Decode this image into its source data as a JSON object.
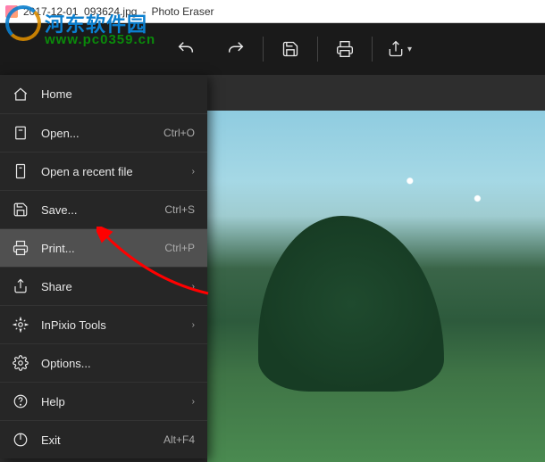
{
  "titlebar": {
    "filename": "2017-12-01_093624.jpg",
    "app_name": "Photo Eraser"
  },
  "watermark": {
    "text_main": "河东软件园",
    "text_url": "www.pc0359.cn"
  },
  "toolbar": {
    "undo_icon": "undo-icon",
    "redo_icon": "redo-icon",
    "save_icon": "save-icon",
    "print_icon": "print-icon",
    "share_icon": "share-icon"
  },
  "menu": {
    "items": [
      {
        "icon": "home-icon",
        "label": "Home",
        "shortcut": "",
        "has_sub": false,
        "highlighted": false
      },
      {
        "icon": "open-icon",
        "label": "Open...",
        "shortcut": "Ctrl+O",
        "has_sub": false,
        "highlighted": false
      },
      {
        "icon": "recent-icon",
        "label": "Open a recent file",
        "shortcut": "",
        "has_sub": true,
        "highlighted": false
      },
      {
        "icon": "save-icon",
        "label": "Save...",
        "shortcut": "Ctrl+S",
        "has_sub": false,
        "highlighted": false
      },
      {
        "icon": "print-icon",
        "label": "Print...",
        "shortcut": "Ctrl+P",
        "has_sub": false,
        "highlighted": true
      },
      {
        "icon": "share-icon",
        "label": "Share",
        "shortcut": "",
        "has_sub": true,
        "highlighted": false
      },
      {
        "icon": "tools-icon",
        "label": "InPixio Tools",
        "shortcut": "",
        "has_sub": true,
        "highlighted": false
      },
      {
        "icon": "options-icon",
        "label": "Options...",
        "shortcut": "",
        "has_sub": false,
        "highlighted": false
      },
      {
        "icon": "help-icon",
        "label": "Help",
        "shortcut": "",
        "has_sub": true,
        "highlighted": false
      },
      {
        "icon": "exit-icon",
        "label": "Exit",
        "shortcut": "Alt+F4",
        "has_sub": false,
        "highlighted": false
      }
    ]
  },
  "colors": {
    "menu_bg": "#262626",
    "highlight": "#505050",
    "text": "#e8e8e8",
    "shortcut": "#aaaaaa",
    "arrow": "#ff0000"
  }
}
